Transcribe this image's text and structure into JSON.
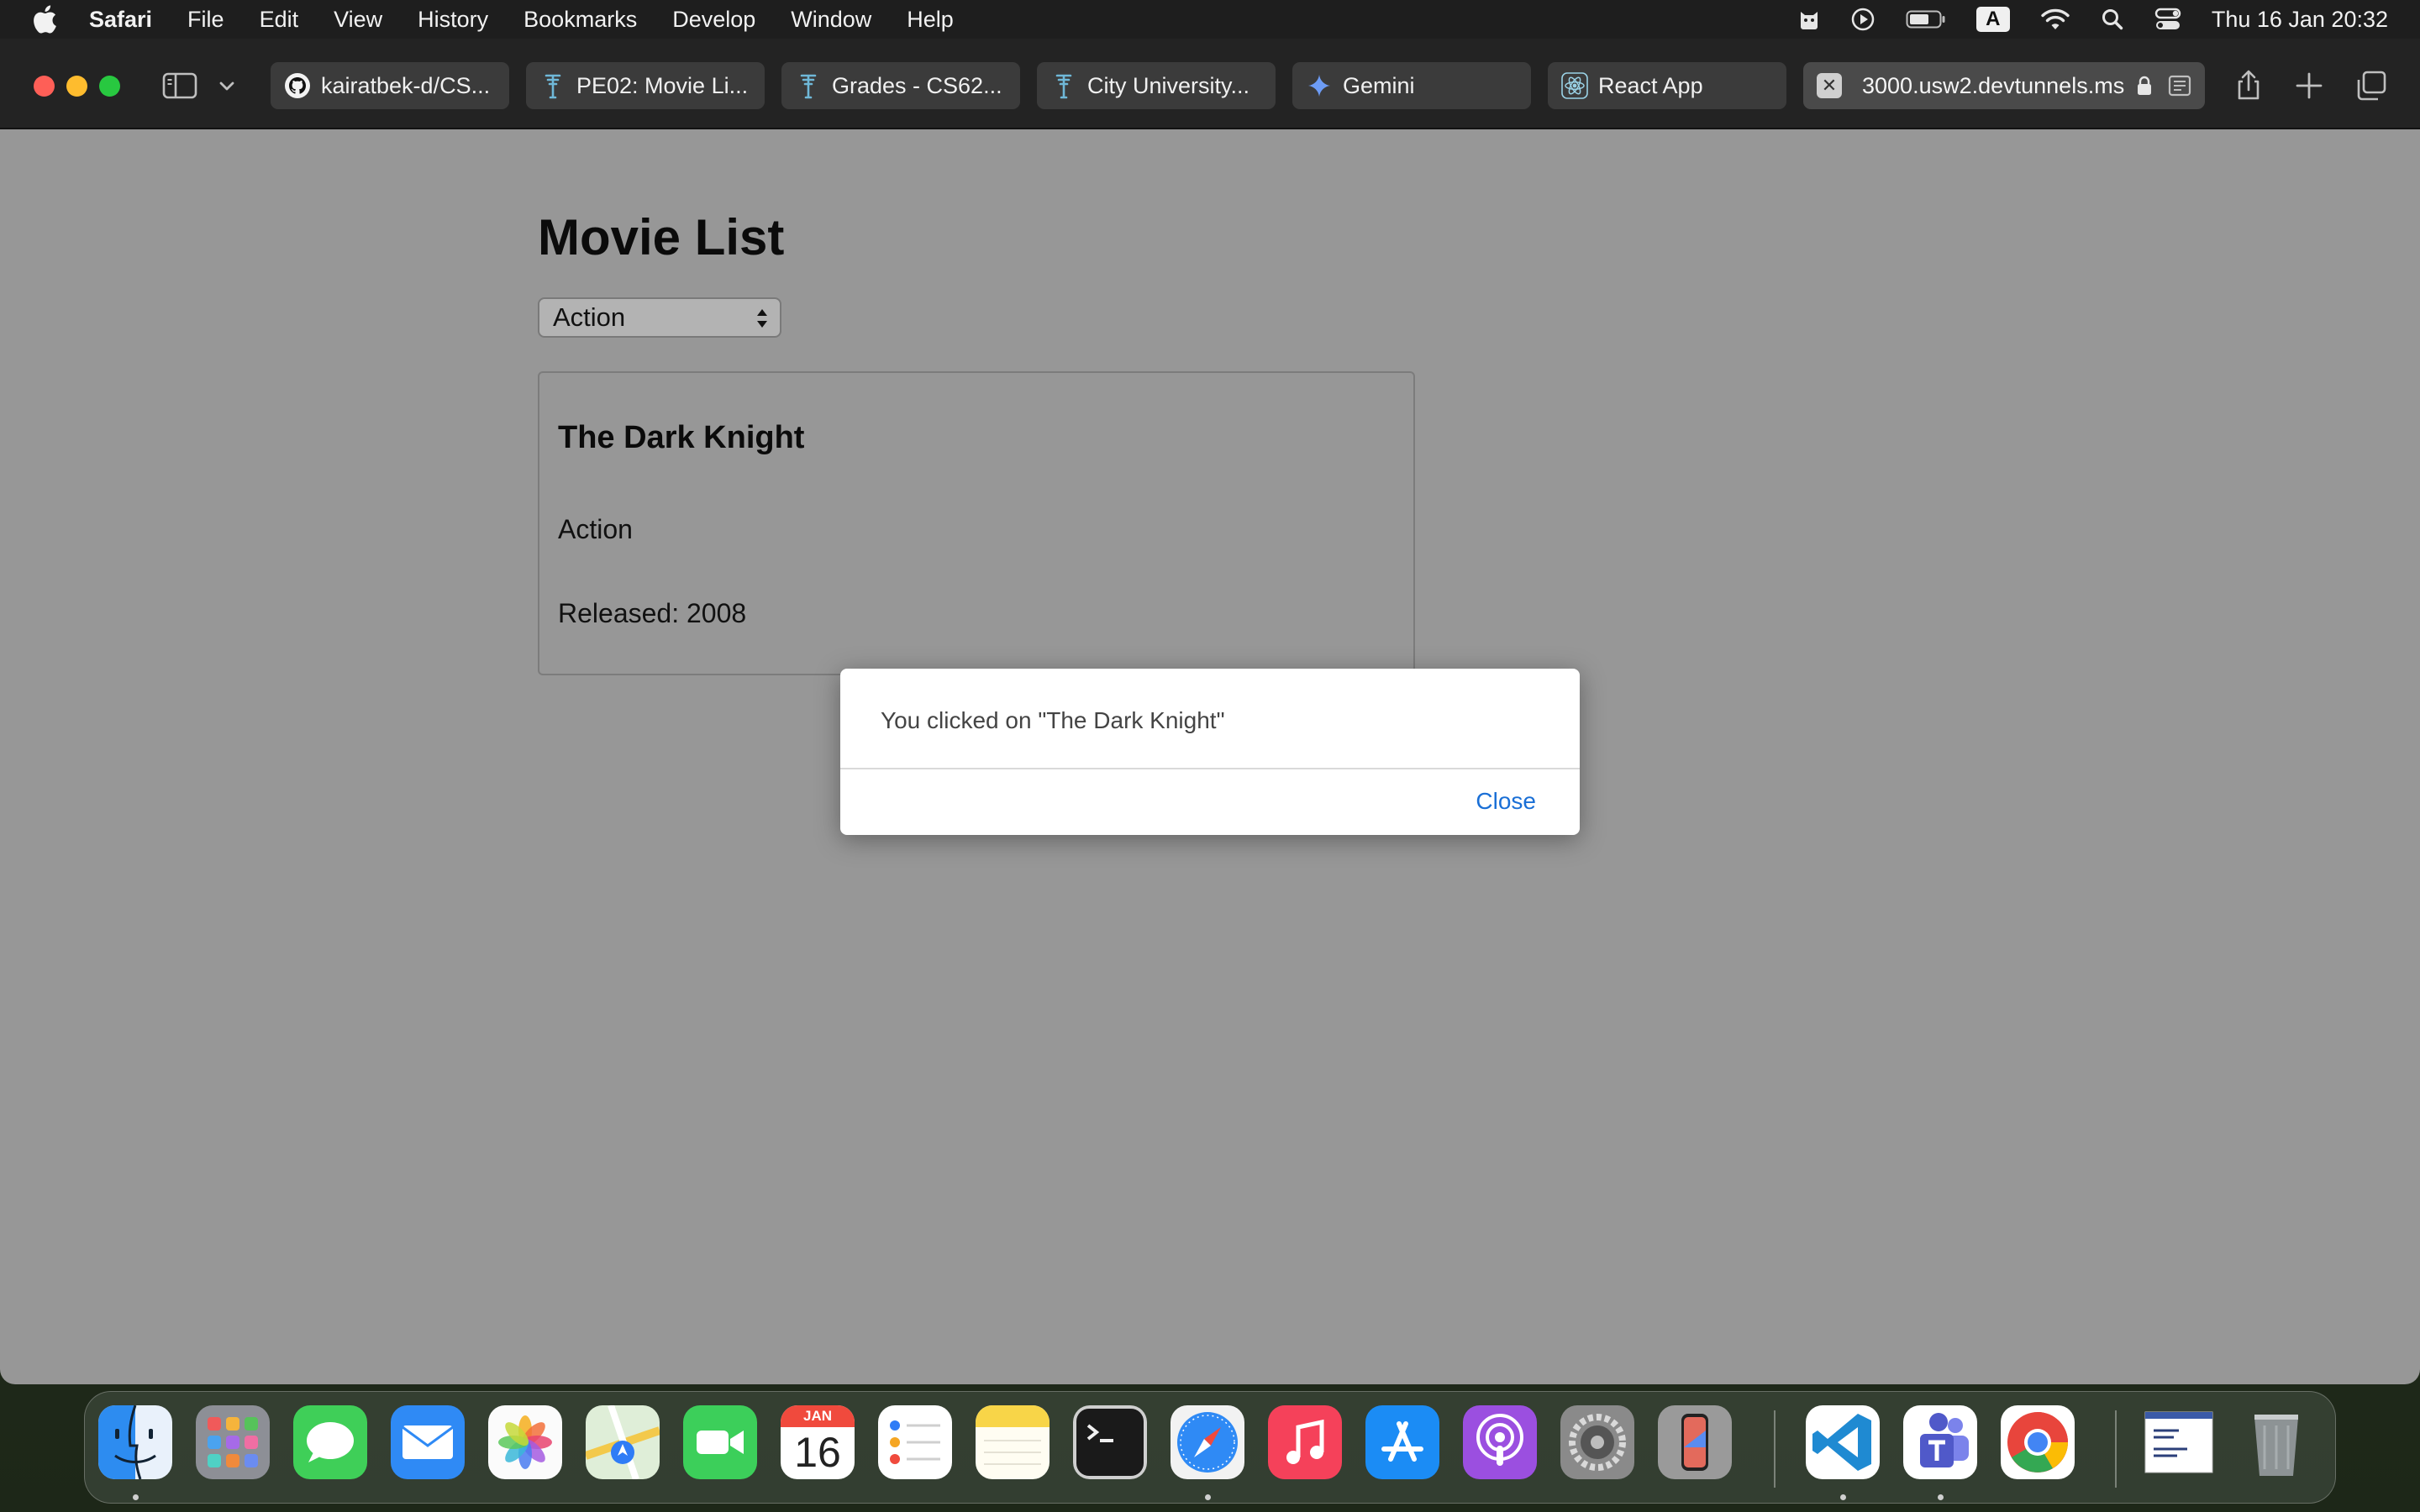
{
  "menubar": {
    "app_name": "Safari",
    "items": [
      "File",
      "Edit",
      "View",
      "History",
      "Bookmarks",
      "Develop",
      "Window",
      "Help"
    ],
    "input_source": "A",
    "clock": "Thu 16 Jan  20:32"
  },
  "tabs": [
    {
      "label": "kairatbek-d/CS...",
      "icon": "github-icon"
    },
    {
      "label": "PE02: Movie Li...",
      "icon": "cityu-icon"
    },
    {
      "label": "Grades - CS62...",
      "icon": "cityu-icon"
    },
    {
      "label": "City University...",
      "icon": "cityu-icon"
    },
    {
      "label": "Gemini",
      "icon": "gemini-icon"
    },
    {
      "label": "React App",
      "icon": "react-icon"
    },
    {
      "label": "3000.usw2.devtunnels.ms",
      "icon": "close-icon"
    }
  ],
  "page": {
    "title": "Movie List",
    "genre_select": {
      "selected": "Action"
    },
    "movie": {
      "title": "The Dark Knight",
      "genre": "Action",
      "released": "Released: 2008"
    }
  },
  "dialog": {
    "message": "You clicked on \"The Dark Knight\"",
    "close_label": "Close"
  },
  "dock": {
    "calendar_month": "JAN",
    "calendar_day": "16",
    "apps": [
      "finder-icon",
      "launchpad-icon",
      "messages-icon",
      "mail-icon",
      "photos-icon",
      "maps-icon",
      "facetime-icon",
      "calendar-icon",
      "reminders-icon",
      "notes-icon",
      "terminal-icon",
      "safari-icon",
      "music-icon",
      "app-store-icon",
      "podcasts-icon",
      "system-settings-icon",
      "iphone-mirroring-icon",
      "vscode-icon",
      "teams-icon",
      "chrome-icon",
      "document-preview-icon",
      "trash-icon"
    ]
  }
}
